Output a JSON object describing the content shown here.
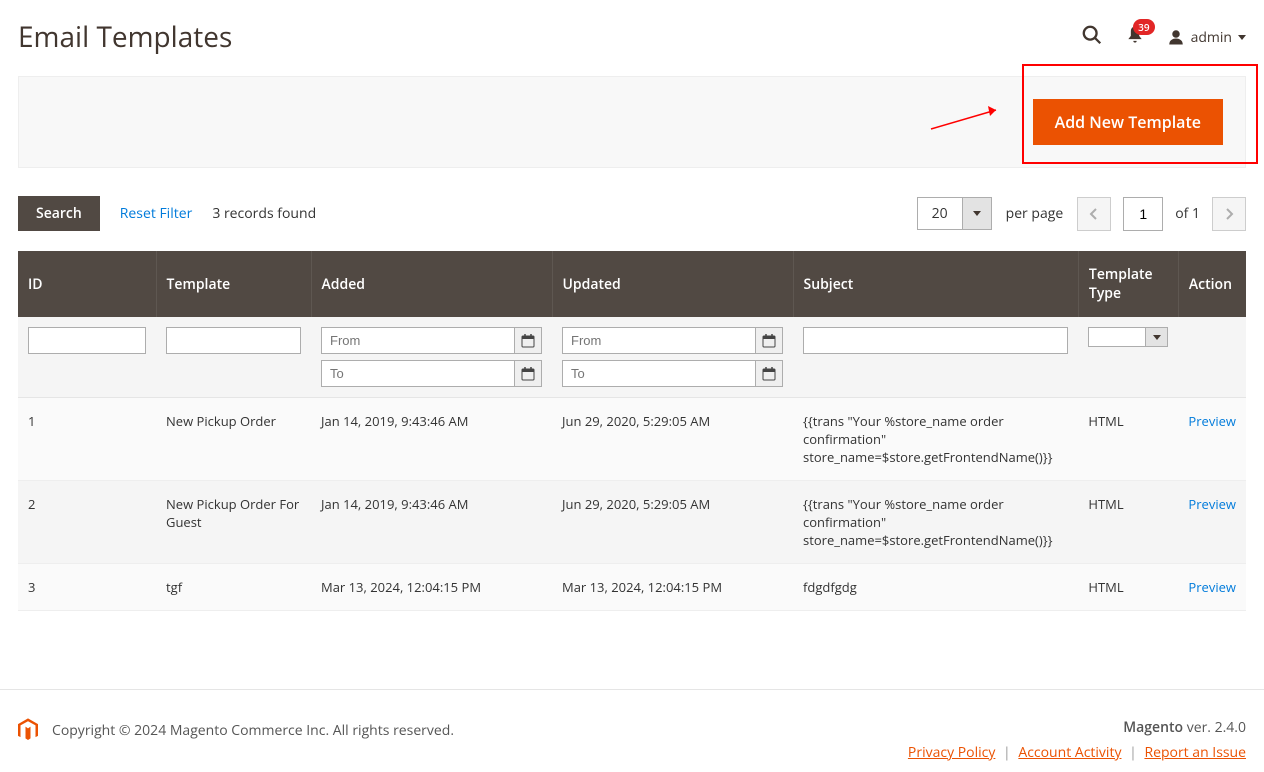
{
  "header": {
    "title": "Email Templates",
    "notification_count": "39",
    "user_label": "admin"
  },
  "action_bar": {
    "add_button": "Add New Template"
  },
  "controls": {
    "search_label": "Search",
    "reset_label": "Reset Filter",
    "records_found": "3 records found",
    "per_page_value": "20",
    "per_page_label": "per page",
    "page_value": "1",
    "page_of": "of 1"
  },
  "table": {
    "columns": {
      "id": "ID",
      "template": "Template",
      "added": "Added",
      "updated": "Updated",
      "subject": "Subject",
      "type": "Template Type",
      "action": "Action"
    },
    "filters": {
      "from_placeholder": "From",
      "to_placeholder": "To"
    },
    "rows": [
      {
        "id": "1",
        "template": "New Pickup Order",
        "added": "Jan 14, 2019, 9:43:46 AM",
        "updated": "Jun 29, 2020, 5:29:05 AM",
        "subject": "{{trans \"Your %store_name order confirmation\" store_name=$store.getFrontendName()}}",
        "type": "HTML",
        "action": "Preview"
      },
      {
        "id": "2",
        "template": "New Pickup Order For Guest",
        "added": "Jan 14, 2019, 9:43:46 AM",
        "updated": "Jun 29, 2020, 5:29:05 AM",
        "subject": "{{trans \"Your %store_name order confirmation\" store_name=$store.getFrontendName()}}",
        "type": "HTML",
        "action": "Preview"
      },
      {
        "id": "3",
        "template": "tgf",
        "added": "Mar 13, 2024, 12:04:15 PM",
        "updated": "Mar 13, 2024, 12:04:15 PM",
        "subject": "fdgdfgdg",
        "type": "HTML",
        "action": "Preview"
      }
    ]
  },
  "footer": {
    "copyright": "Copyright © 2024 Magento Commerce Inc. All rights reserved.",
    "product": "Magento",
    "version": " ver. 2.4.0",
    "links": {
      "privacy": "Privacy Policy",
      "activity": " Account Activity",
      "report": "Report an Issue"
    }
  }
}
